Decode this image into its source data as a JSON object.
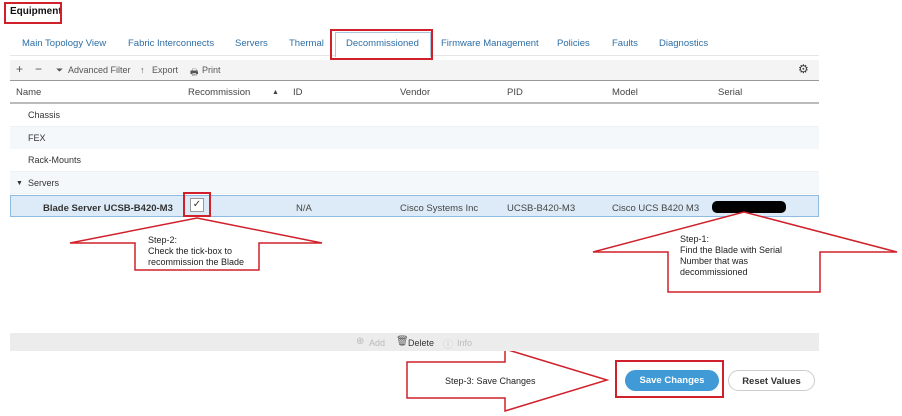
{
  "title": "Equipment",
  "tabs": [
    "Main Topology View",
    "Fabric Interconnects",
    "Servers",
    "Thermal",
    "Decommissioned",
    "Firmware Management",
    "Policies",
    "Faults",
    "Diagnostics"
  ],
  "active_tab": "Decommissioned",
  "toolbar": {
    "add": "+",
    "remove": "−",
    "advanced_filter": "Advanced Filter",
    "export": "Export",
    "print": "Print"
  },
  "columns": [
    "Name",
    "Recommission",
    "ID",
    "Vendor",
    "PID",
    "Model",
    "Serial"
  ],
  "groups": [
    "Chassis",
    "FEX",
    "Rack-Mounts",
    "Servers"
  ],
  "server_row": {
    "name": "Blade Server UCSB-B420-M3",
    "recommission": true,
    "id": "N/A",
    "vendor": "Cisco Systems Inc",
    "pid": "UCSB-B420-M3",
    "model": "Cisco UCS B420 M3"
  },
  "bottom_bar": {
    "add": "Add",
    "delete": "Delete",
    "info": "Info"
  },
  "buttons": {
    "save": "Save Changes",
    "reset": "Reset Values"
  },
  "callouts": {
    "step2_title": "Step-2:",
    "step2_text": "Check the tick-box to recommission the Blade",
    "step1_title": "Step-1:",
    "step1_text": "Find the Blade with Serial Number that was decommissioned",
    "step3": "Step-3: Save Changes"
  },
  "colors": {
    "accent": "#3f9ad6",
    "annotation": "#d0202a",
    "highlight": "#dcebf7"
  }
}
